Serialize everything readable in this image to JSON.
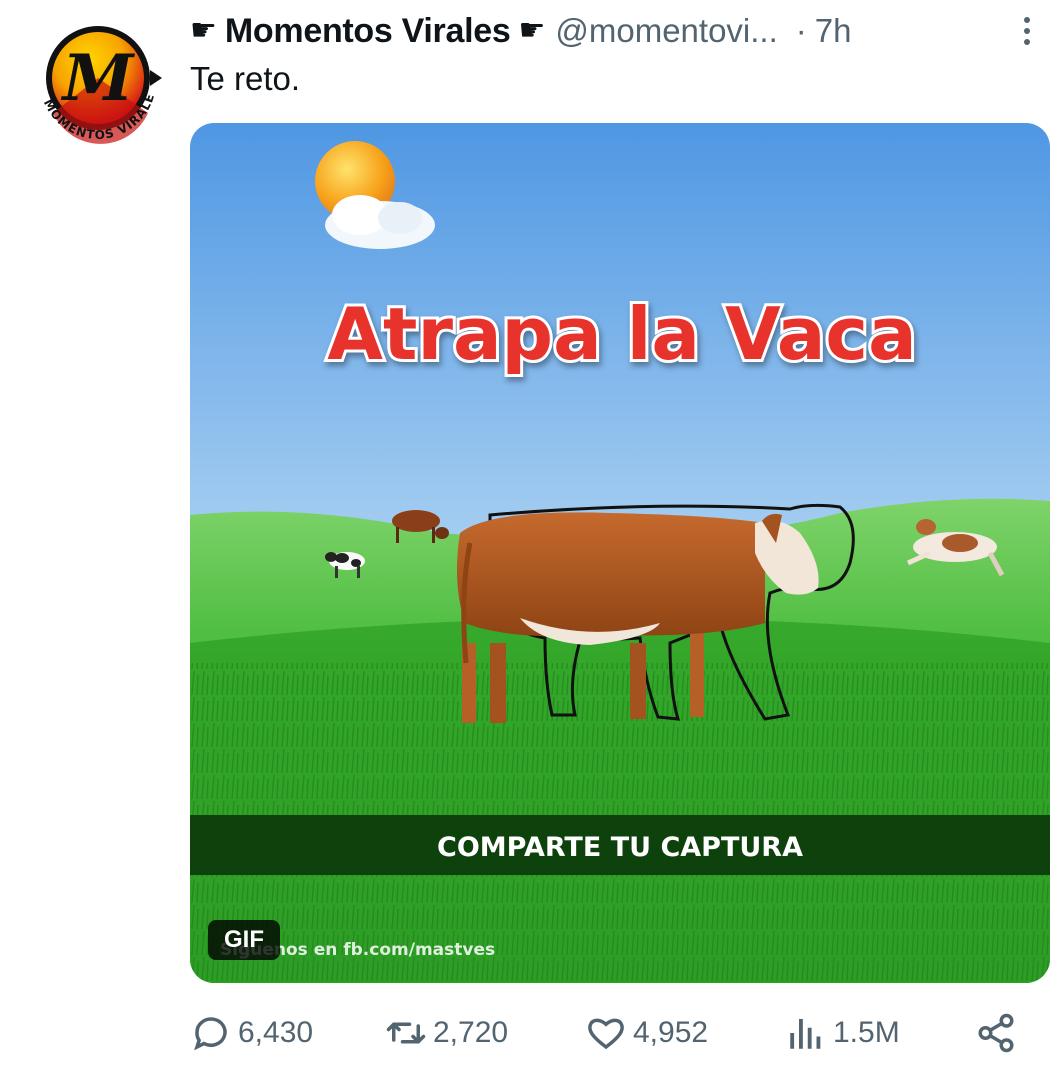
{
  "author": {
    "name": "Momentos Virales",
    "hand_emoji": "☛",
    "handle": "@momentovi...",
    "time_separator": "·",
    "time": "7h",
    "avatar_text": "MOMENTOS VIRALES",
    "avatar_monogram": "M"
  },
  "tweet": {
    "text": "Te reto."
  },
  "media": {
    "title": "Atrapa la Vaca",
    "banner": "COMPARTE TU CAPTURA",
    "watermark": "Síguenos en fb.com/mastves",
    "badge": "GIF"
  },
  "actions": {
    "replies": "6,430",
    "retweets": "2,720",
    "likes": "4,952",
    "views": "1.5M"
  },
  "colors": {
    "text": "#0f1419",
    "muted": "#536471",
    "title_red": "#e8322c",
    "grass": "#3cb531",
    "sky_top": "#4f97e3"
  }
}
